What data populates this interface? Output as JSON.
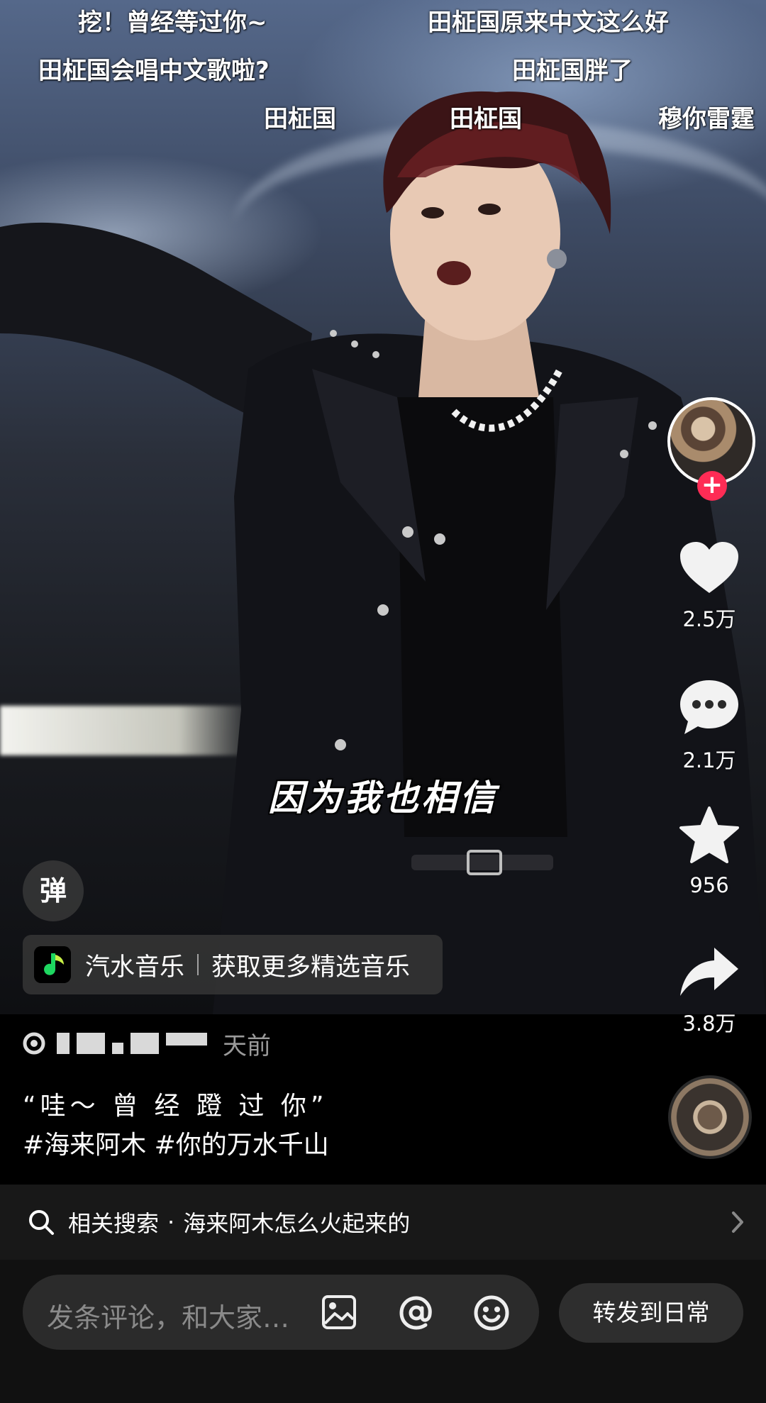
{
  "danmaku": [
    "挖！曾经等过你~",
    "田柾国原来中文这么好",
    "田柾国会唱中文歌啦?",
    "田柾国胖了",
    "田柾国",
    "田柾国",
    "穆你雷霆"
  ],
  "subtitle": "因为我也相信",
  "actions": {
    "likes": "2.5万",
    "comments": "2.1万",
    "favorites": "956",
    "shares": "3.8万"
  },
  "danmu_toggle_label": "弹",
  "music": {
    "app": "汽水音乐",
    "cta": "获取更多精选音乐"
  },
  "meta_suffix": "天前",
  "description": {
    "quote": "“哇～ 曾 经 蹬 过 你”",
    "hashtags": "#海来阿木 #你的万水千山"
  },
  "related_search": {
    "prefix": "相关搜索",
    "separator": "·",
    "query": "海来阿木怎么火起来的"
  },
  "comment": {
    "placeholder": "发条评论，和大家…"
  },
  "share_daily_label": "转发到日常",
  "colors": {
    "follow_red": "#fe2c55",
    "music_green": "#1ed760"
  },
  "icons": [
    "heart-icon",
    "comment-bubble-icon",
    "star-icon",
    "share-arrow-icon",
    "search-icon",
    "chevron-right-icon",
    "image-icon",
    "at-icon",
    "emoji-icon",
    "music-app-logo"
  ]
}
